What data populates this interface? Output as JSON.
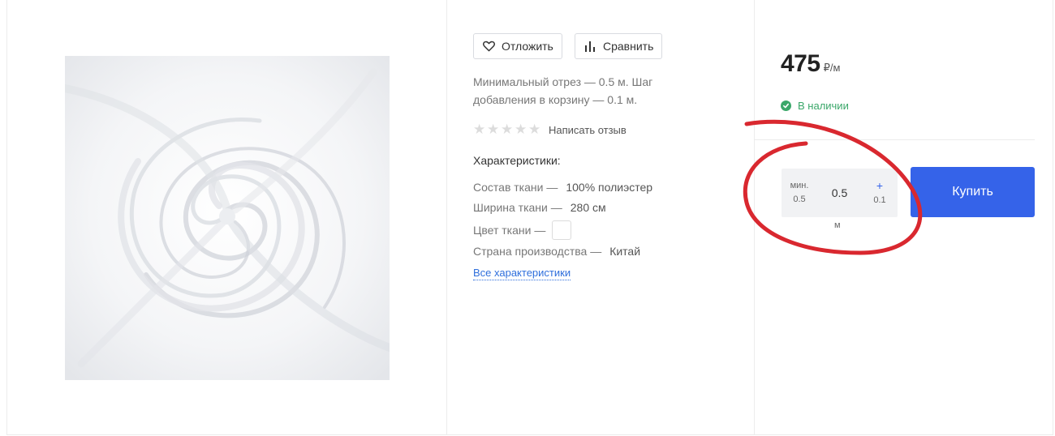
{
  "actions": {
    "defer_label": "Отложить",
    "compare_label": "Сравнить"
  },
  "product": {
    "description": "Минимальный отрез — 0.5 м. Шаг добавления в корзину — 0.1 м.",
    "rating": {
      "value": 0,
      "max": 5,
      "review_link": "Написать отзыв"
    },
    "specs_title": "Характеристики:",
    "specs": [
      {
        "label": "Состав ткани —",
        "value": "100% полиэстер"
      },
      {
        "label": "Ширина ткани —",
        "value": "280 см"
      },
      {
        "label": "Цвет ткани —",
        "value": ""
      },
      {
        "label": "Страна производства —",
        "value": "Китай"
      }
    ],
    "all_specs_link": "Все характеристики"
  },
  "purchase": {
    "price": "475",
    "price_unit": "₽/м",
    "stock": "В наличии",
    "qty": {
      "min_label": "мин.",
      "min_value": "0.5",
      "value": "0.5",
      "plus": "+",
      "step": "0.1",
      "unit": "м"
    },
    "buy_label": "Купить"
  },
  "colors": {
    "accent": "#3563e9",
    "stock_green": "#3aa769",
    "annotation_red": "#d9282f",
    "link_blue": "#2f6fdc"
  },
  "icons": [
    "heart-icon",
    "bar-chart-icon",
    "star-icon",
    "check-circle-icon"
  ]
}
